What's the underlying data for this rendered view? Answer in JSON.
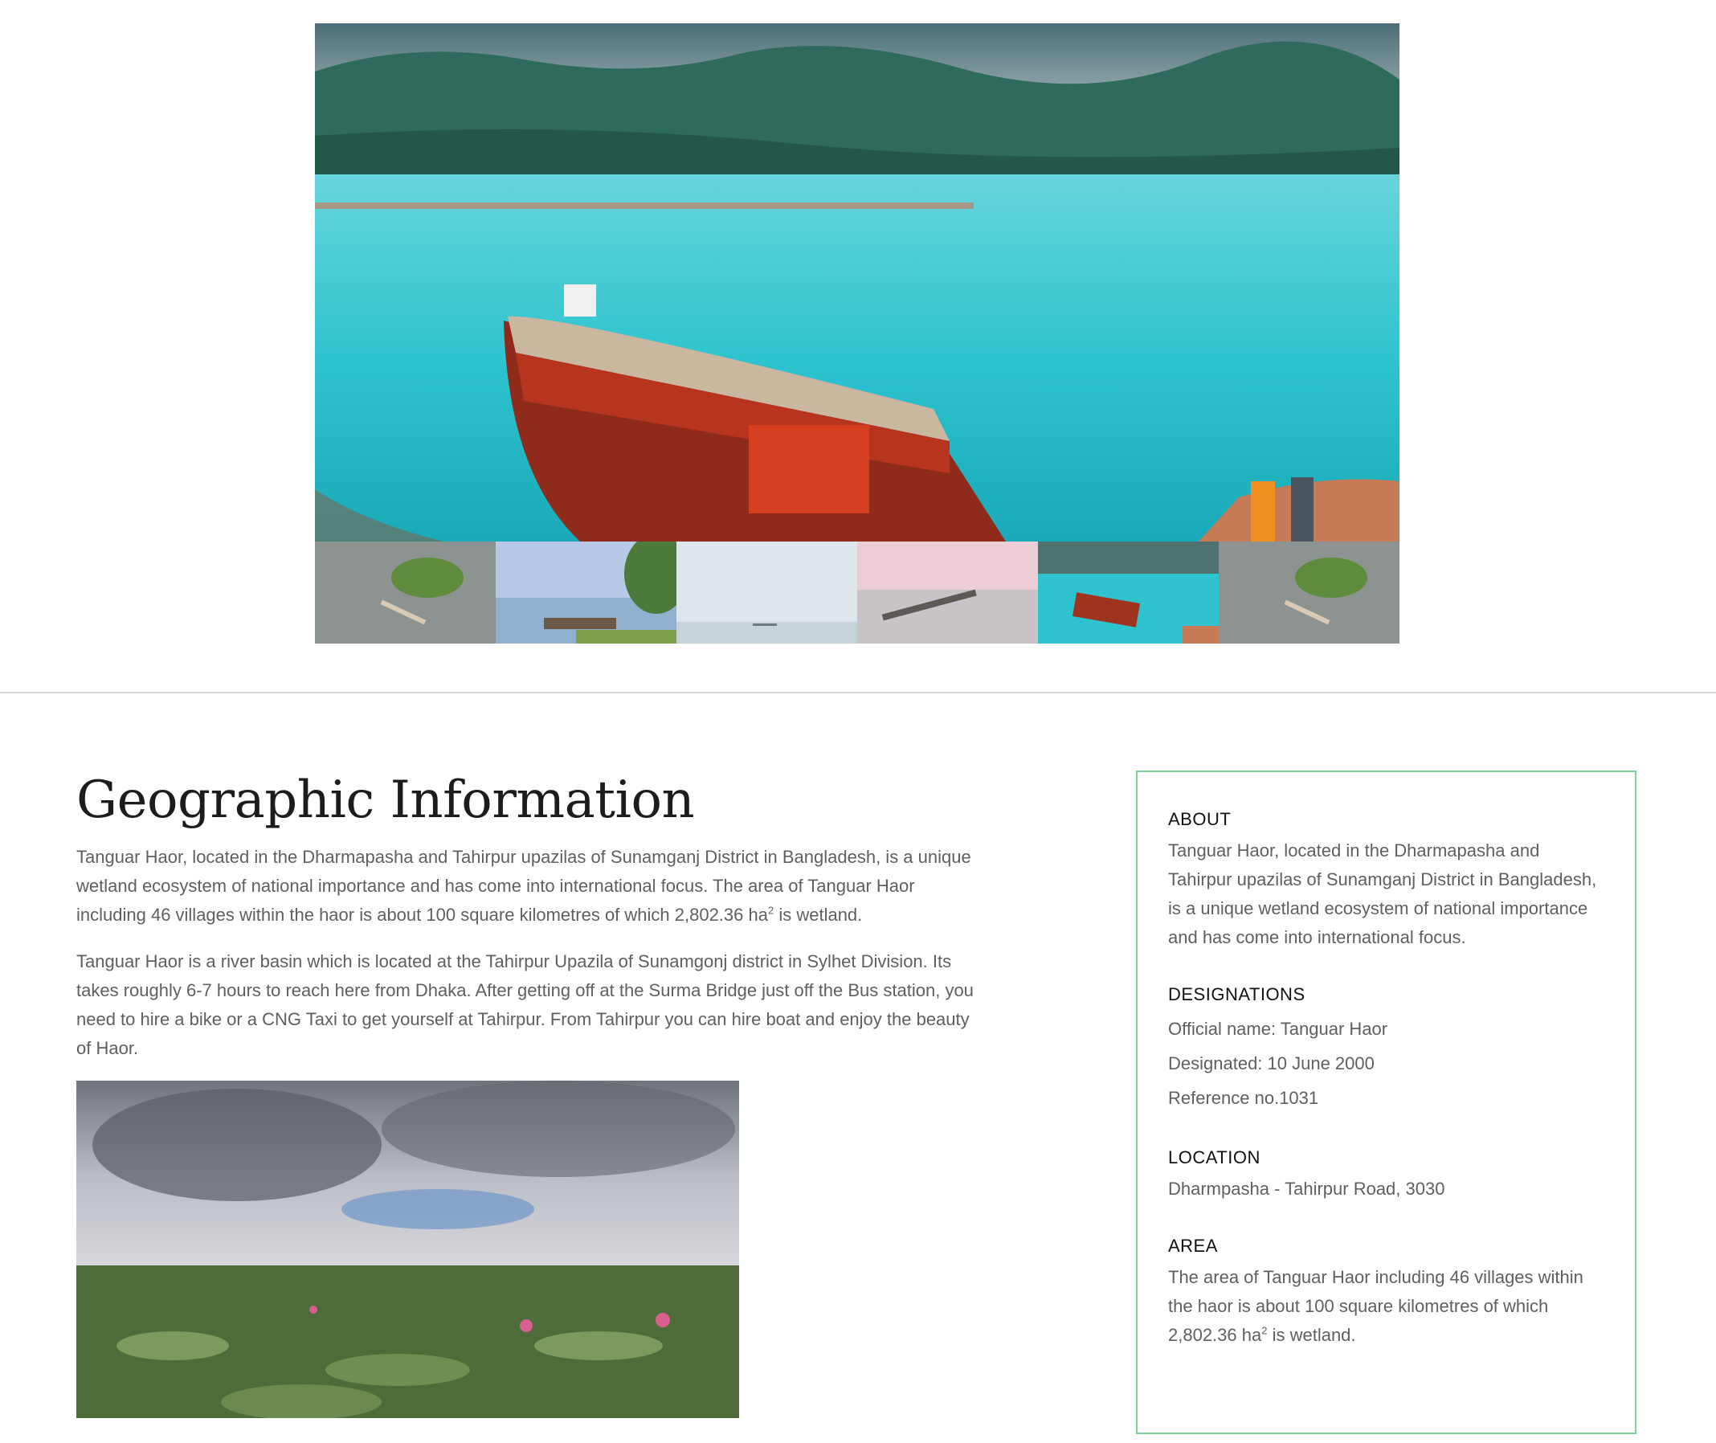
{
  "gallery": {
    "thumbnails": [
      {
        "name": "aerial-boat-lily"
      },
      {
        "name": "boat-with-tree"
      },
      {
        "name": "misty-lake"
      },
      {
        "name": "canoe-pink-sky"
      },
      {
        "name": "houseboat-turquoise"
      },
      {
        "name": "aerial-boat-lily"
      }
    ]
  },
  "main": {
    "title": "Geographic Information",
    "paragraph1_part1": "Tanguar Haor, located in the Dharmapasha and Tahirpur upazilas of Sunamganj District in Bangladesh, is a unique wetland ecosystem of national importance and has come into international focus. The area of Tanguar Haor including 46 villages within the haor is about 100 square kilometres of which 2,802.36 ha",
    "paragraph1_sup": "2",
    "paragraph1_part2": " is wetland.",
    "paragraph2": "Tanguar Haor is a river basin which is located at the Tahirpur Upazila of Sunamgonj district in Sylhet Division. Its takes roughly 6-7 hours to reach here from Dhaka. After getting off at the Surma Bridge just off the Bus station, you need to hire a bike or a CNG Taxi to get yourself at Tahirpur. From Tahirpur you can hire boat and enjoy the beauty of Haor."
  },
  "infobox": {
    "border_color": "#7fcf9f",
    "about": {
      "heading": "ABOUT",
      "text": "Tanguar Haor, located in the Dharmapasha and Tahirpur upazilas of Sunamganj District in Bangladesh, is a unique wetland ecosystem of national importance and has come into international focus."
    },
    "designations": {
      "heading": "DESIGNATIONS",
      "official_name": "Official name: Tanguar Haor",
      "designated": "Designated: 10 June 2000",
      "reference": "Reference no.1031"
    },
    "location": {
      "heading": "LOCATION",
      "text": "Dharmpasha - Tahirpur Road, 3030"
    },
    "area": {
      "heading": "AREA",
      "text_part1": "The area of Tanguar Haor including 46 villages within the haor is about 100 square kilometres of which 2,802.36 ha",
      "text_sup": "2",
      "text_part2": " is wetland."
    }
  }
}
